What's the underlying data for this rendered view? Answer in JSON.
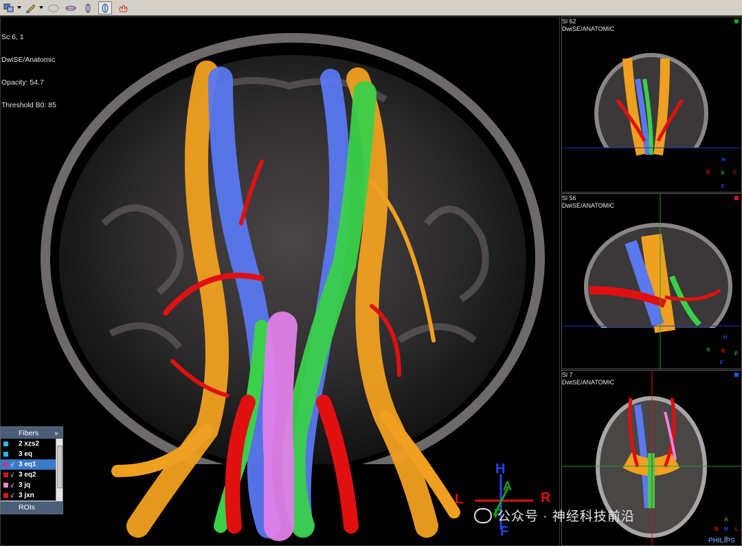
{
  "toolbar": {
    "icons": [
      "layers-icon",
      "pen-icon",
      "ellipse-icon",
      "rotate-icon",
      "view-side-icon",
      "view-sagittal-icon",
      "hand-icon"
    ]
  },
  "main_view": {
    "info_lines": [
      "Sc 6, 1",
      "DwiSE/Anatomic",
      "Opacity: 54.7",
      "Threshold B0: 85"
    ],
    "orientation": {
      "top": "H",
      "left": "L",
      "right": "R",
      "center_a": "A",
      "center_p": "P",
      "bottom": "F"
    }
  },
  "fibers_panel": {
    "title": "Fibers",
    "collapse": "»",
    "items": [
      {
        "label": "2 xzs2",
        "color": "#22b8f0",
        "checked": ""
      },
      {
        "label": "3 eq",
        "color": "#22b8f0",
        "checked": ""
      },
      {
        "label": "3 eq1",
        "color": "#b83a8a",
        "checked": "√",
        "selected": true
      },
      {
        "label": "3 eq2",
        "color": "#e01010",
        "checked": "√"
      },
      {
        "label": "3 jq",
        "color": "#ff7fd8",
        "checked": "√"
      },
      {
        "label": "3 jxn",
        "color": "#e01010",
        "checked": "√"
      }
    ],
    "roi_label": "ROIs"
  },
  "side_views": [
    {
      "title": "Sl 62",
      "subtitle": "DwiSE/ANATOMIC",
      "marker_color": "#1aa31a",
      "orient": {
        "left": "R",
        "right": "L",
        "top": "H",
        "bottom": "F",
        "center": "A"
      }
    },
    {
      "title": "Sl 56",
      "subtitle": "DwiSE/ANATOMIC",
      "marker_color": "#e01010",
      "orient": {
        "left": "A",
        "right": "P",
        "top": "H",
        "bottom": "F",
        "center": "R"
      }
    },
    {
      "title": "Sl 7",
      "subtitle": "DwiSE/ANATOMIC",
      "marker_color": "#2255ee",
      "orient": {
        "left": "R",
        "right": "L",
        "top": "A",
        "bottom": "P",
        "center": "H"
      }
    }
  ],
  "watermark": "公众号 · 神经科技前沿",
  "brand": "PHILIPS"
}
